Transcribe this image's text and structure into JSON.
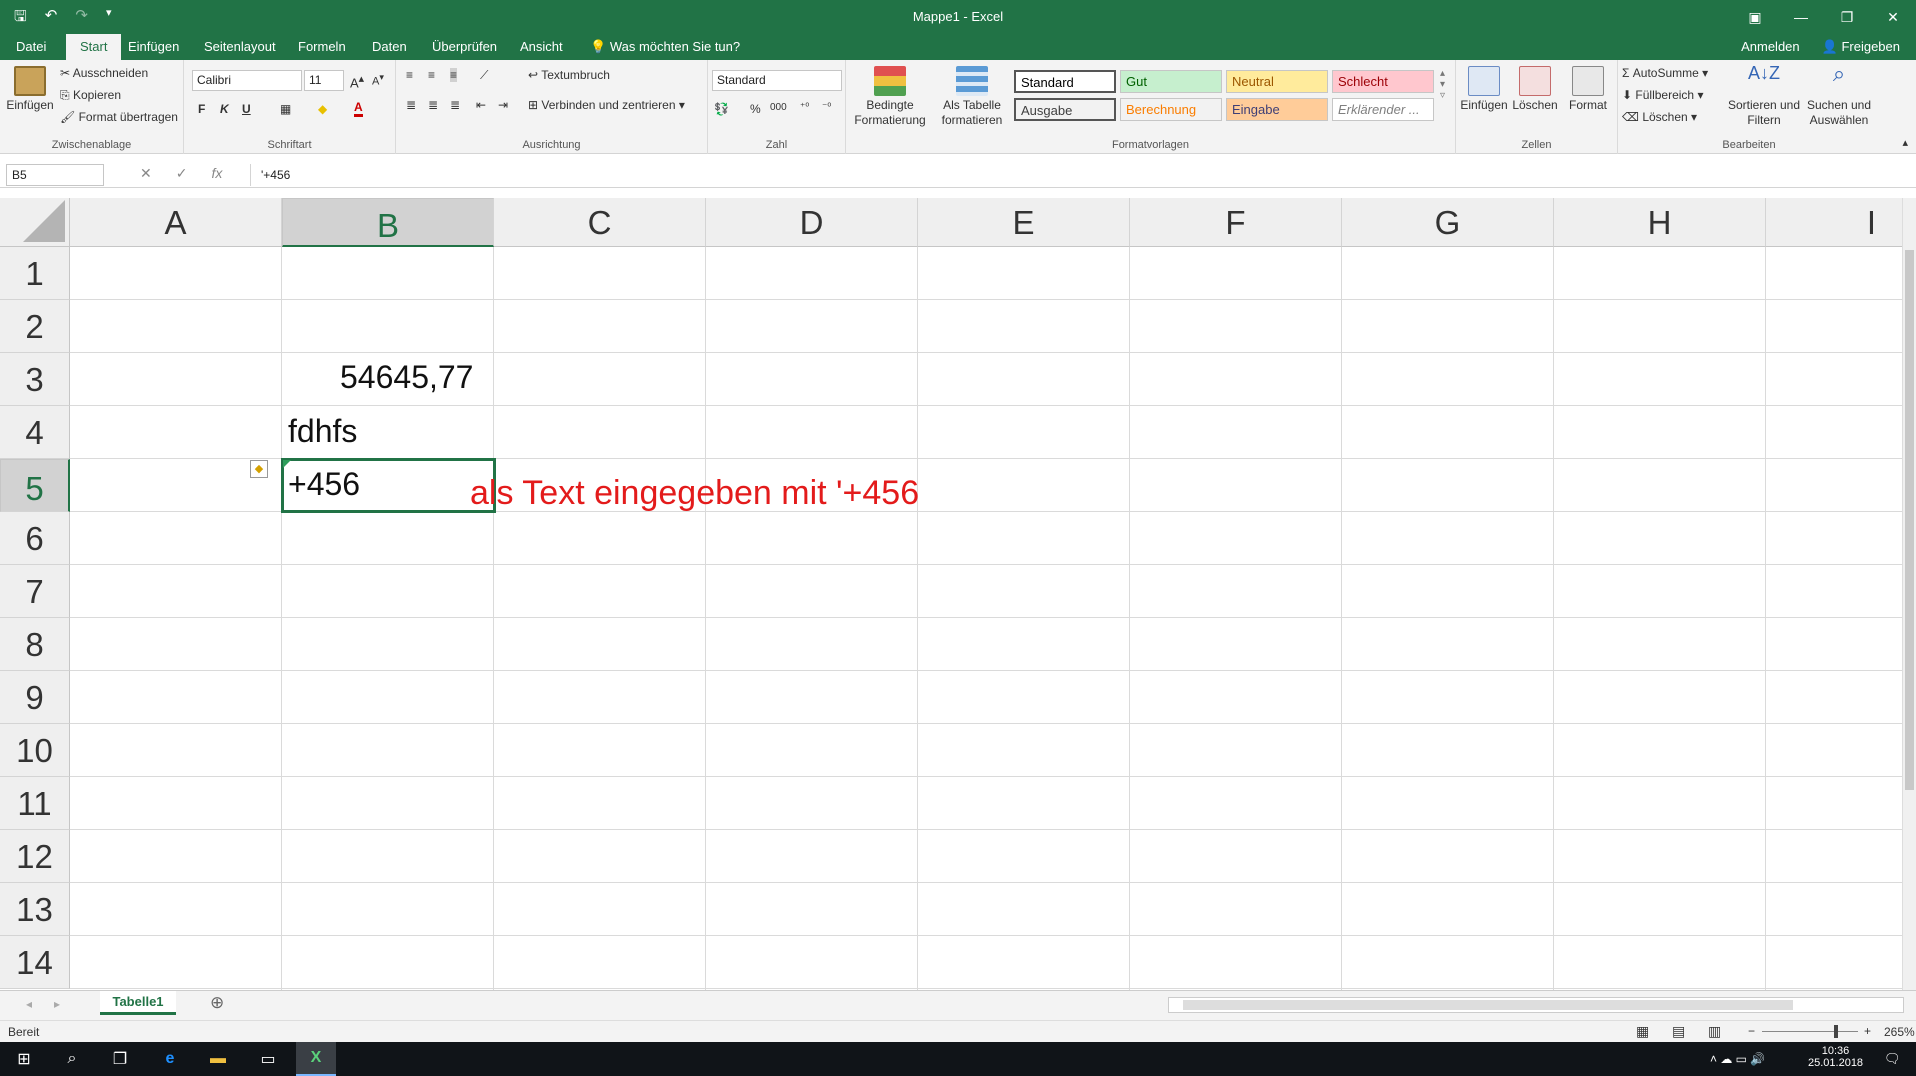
{
  "window": {
    "title": "Mappe1 - Excel"
  },
  "qat": {
    "save_icon": "save-icon",
    "undo_icon": "undo-icon",
    "redo_icon": "redo-icon",
    "customize": "▾"
  },
  "tabs": [
    "Datei",
    "Start",
    "Einfügen",
    "Seitenlayout",
    "Formeln",
    "Daten",
    "Überprüfen",
    "Ansicht"
  ],
  "active_tab": "Start",
  "tellme": "Was möchten Sie tun?",
  "account": {
    "signin": "Anmelden",
    "share": "Freigeben"
  },
  "clipboard": {
    "paste": "Einfügen",
    "cut": "Ausschneiden",
    "copy": "Kopieren",
    "format_painter": "Format übertragen",
    "group": "Zwischenablage"
  },
  "font": {
    "name": "Calibri",
    "size": "11",
    "bold": "F",
    "italic": "K",
    "underline": "U",
    "group": "Schriftart"
  },
  "alignment": {
    "wrap": "Textumbruch",
    "merge": "Verbinden und zentrieren",
    "group": "Ausrichtung"
  },
  "number": {
    "format": "Standard",
    "percent": "%",
    "thousands": "000",
    "group": "Zahl"
  },
  "styles": {
    "conditional": "Bedingte Formatierung",
    "as_table": "Als Tabelle formatieren",
    "cells": [
      {
        "label": "Standard",
        "bg": "#ffffff",
        "fg": "#000000"
      },
      {
        "label": "Gut",
        "bg": "#c6efce",
        "fg": "#006100"
      },
      {
        "label": "Neutral",
        "bg": "#ffeb9c",
        "fg": "#9c5700"
      },
      {
        "label": "Schlecht",
        "bg": "#ffc7ce",
        "fg": "#9c0006"
      },
      {
        "label": "Ausgabe",
        "bg": "#f2f2f2",
        "fg": "#3f3f3f"
      },
      {
        "label": "Berechnung",
        "bg": "#f2f2f2",
        "fg": "#fa7d00"
      },
      {
        "label": "Eingabe",
        "bg": "#ffcc99",
        "fg": "#3f3f76"
      },
      {
        "label": "Erklärender ...",
        "bg": "#ffffff",
        "fg": "#7f7f7f"
      }
    ],
    "group": "Formatvorlagen"
  },
  "cells_group": {
    "insert": "Einfügen",
    "delete": "Löschen",
    "format": "Format",
    "group": "Zellen"
  },
  "editing": {
    "autosum": "AutoSumme",
    "fill": "Füllbereich",
    "clear": "Löschen",
    "sort": "Sortieren und Filtern",
    "find": "Suchen und Auswählen",
    "group": "Bearbeiten"
  },
  "formula_bar": {
    "name_box": "B5",
    "cancel": "✕",
    "enter": "✓",
    "fx": "fx",
    "content": "'+456"
  },
  "columns": [
    "A",
    "B",
    "C",
    "D",
    "E",
    "F",
    "G",
    "H",
    "I"
  ],
  "selected_column": "B",
  "rows": [
    "1",
    "2",
    "3",
    "4",
    "5",
    "6",
    "7",
    "8",
    "9",
    "10",
    "11",
    "12",
    "13",
    "14"
  ],
  "selected_row": "5",
  "cells": {
    "B3": "54645,77",
    "B4": "fdhfs",
    "B5": "+456"
  },
  "annotation": "als Text eingegeben mit '+456",
  "sheet": {
    "tab": "Tabelle1",
    "add": "⊕"
  },
  "status": {
    "ready": "Bereit",
    "zoom": "265%"
  },
  "taskbar": {
    "time": "10:36",
    "date": "25.01.2018"
  },
  "colors": {
    "excel_green": "#217346",
    "annotation_red": "#e31b1b"
  }
}
